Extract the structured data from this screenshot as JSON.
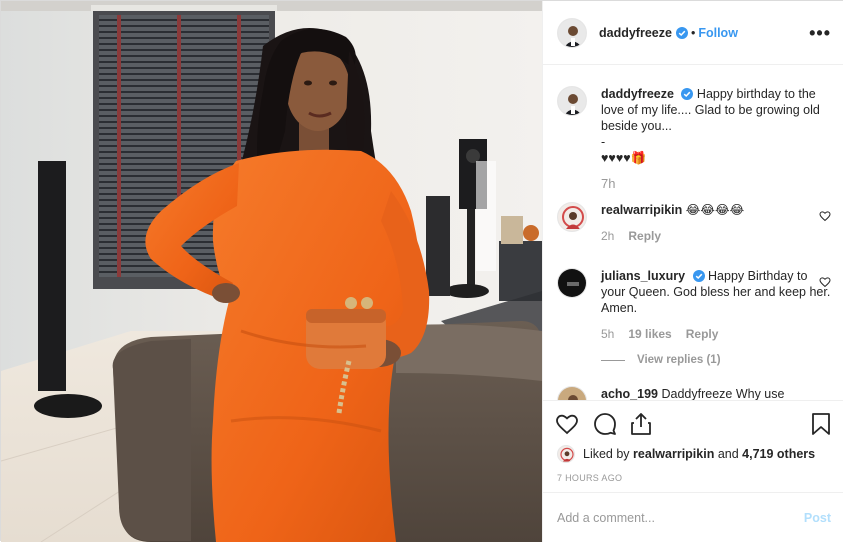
{
  "post": {
    "username": "daddyfreeze",
    "follow_label": "Follow",
    "more_label": "•••",
    "caption": {
      "username": "daddyfreeze",
      "line1": "Happy birthday to the love of my life.... Glad to be growing old beside you...",
      "line2": "-",
      "line3": "♥♥♥♥🎁",
      "time": "7h"
    },
    "comments": [
      {
        "username": "realwarripikin",
        "text": "😂😂😂😂",
        "time": "2h",
        "reply": "Reply"
      },
      {
        "username": "julians_luxury",
        "text": "Happy Birthday to your Queen. God bless her and keep her. Amen.",
        "time": "5h",
        "likes": "19 likes",
        "reply": "Reply",
        "view_replies": "View replies (1)"
      },
      {
        "username": "acho_199",
        "text": "Daddyfreeze Why use"
      }
    ],
    "liked_by": {
      "prefix": "Liked by",
      "user": "realwarripikin",
      "and": "and",
      "others": "4,719 others"
    },
    "time_ago": "7 HOURS AGO",
    "add_comment": {
      "placeholder": "Add a comment...",
      "post_label": "Post"
    }
  },
  "icons": {
    "like": "heart-icon",
    "comment": "comment-icon",
    "share": "share-icon",
    "save": "bookmark-icon",
    "verified": "verified-badge-icon"
  },
  "colors": {
    "link": "#3897f0",
    "post_disabled": "#b2dffc",
    "muted": "#999999",
    "dress": "#f26a21"
  }
}
